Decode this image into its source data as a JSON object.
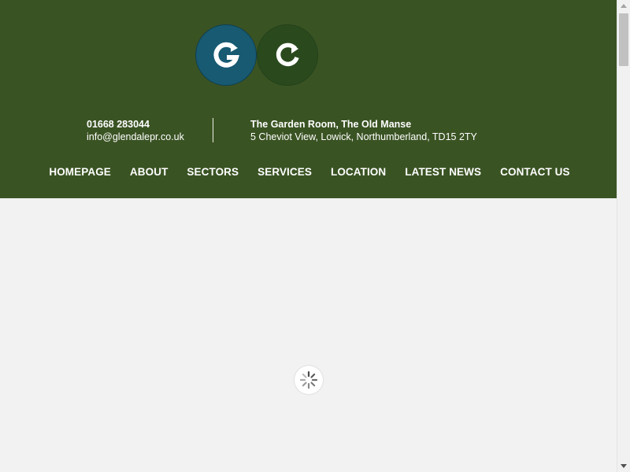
{
  "colors": {
    "header_bg": "#3a5323",
    "logo_g_bg": "#175a72",
    "logo_c_bg": "#2a4a1e",
    "page_bg": "#f2f2f2",
    "text_on_header": "#ffffff"
  },
  "header": {
    "logo": {
      "letters": [
        "G",
        "C"
      ],
      "icons": [
        "g-arrow-logo-icon",
        "c-arrow-logo-icon"
      ]
    },
    "contact": {
      "phone": "01668 283044",
      "email": "info@glendalepr.co.uk"
    },
    "address": {
      "line1": "The Garden Room, The Old Manse",
      "line2": "5 Cheviot View, Lowick, Northumberland, TD15 2TY"
    }
  },
  "nav": {
    "items": [
      {
        "label": "HOMEPAGE"
      },
      {
        "label": "ABOUT"
      },
      {
        "label": "SECTORS"
      },
      {
        "label": "SERVICES"
      },
      {
        "label": "LOCATION"
      },
      {
        "label": "LATEST NEWS"
      },
      {
        "label": "CONTACT US"
      }
    ]
  },
  "main": {
    "loading_icon": "spinner-icon"
  }
}
